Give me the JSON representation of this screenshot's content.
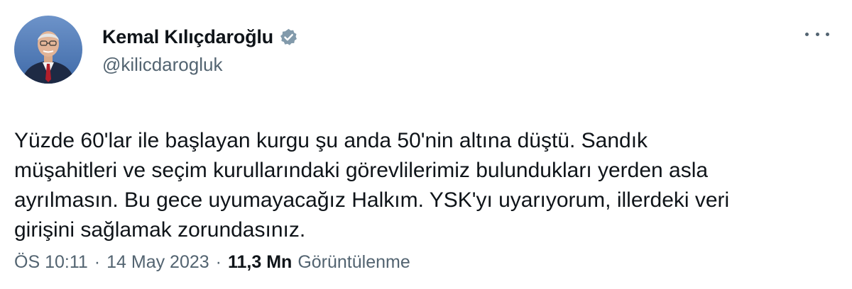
{
  "author": {
    "display_name": "Kemal Kılıçdaroğlu",
    "handle": "@kilicdarogluk",
    "verified_icon": "verified-badge-icon",
    "verified_color": "#829aab"
  },
  "tweet": {
    "text": "Yüzde 60'lar ile başlayan kurgu şu anda 50'nin altına düştü. Sandık\nmüşahitleri ve seçim kurullarındaki görevlilerimiz bulundukları yerden asla\nayrılmasın. Bu gece uyumayacağız Halkım. YSK'yı uyarıyorum, illerdeki veri\ngirişini sağlamak zorundasınız."
  },
  "meta": {
    "time": "ÖS 10:11",
    "separator": "·",
    "date": "14 May 2023",
    "views_count": "11,3 Mn",
    "views_label": "Görüntülenme"
  },
  "more_icon": "more-horizontal-icon"
}
